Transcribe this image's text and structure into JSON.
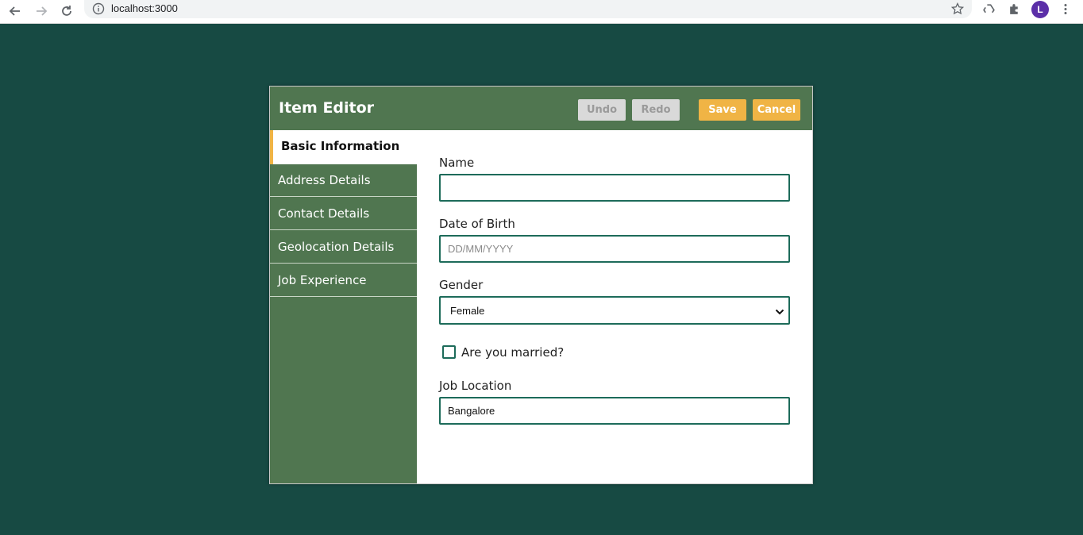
{
  "browser": {
    "url": "localhost:3000",
    "avatar_letter": "L"
  },
  "editor": {
    "title": "Item Editor",
    "buttons": {
      "undo": "Undo",
      "redo": "Redo",
      "save": "Save",
      "cancel": "Cancel"
    },
    "tabs": [
      {
        "label": "Basic Information",
        "active": true
      },
      {
        "label": "Address Details",
        "active": false
      },
      {
        "label": "Contact Details",
        "active": false
      },
      {
        "label": "Geolocation Details",
        "active": false
      },
      {
        "label": "Job Experience",
        "active": false
      }
    ],
    "form": {
      "name_label": "Name",
      "name_value": "",
      "dob_label": "Date of Birth",
      "dob_placeholder": "DD/MM/YYYY",
      "gender_label": "Gender",
      "gender_value": "Female",
      "married_label": "Are you married?",
      "married_checked": false,
      "job_location_label": "Job Location",
      "job_location_value": "Bangalore"
    }
  },
  "colors": {
    "page_background": "#174a43",
    "header_green": "#507650",
    "accent_orange": "#f0b445",
    "field_border": "#1d6b5a"
  }
}
